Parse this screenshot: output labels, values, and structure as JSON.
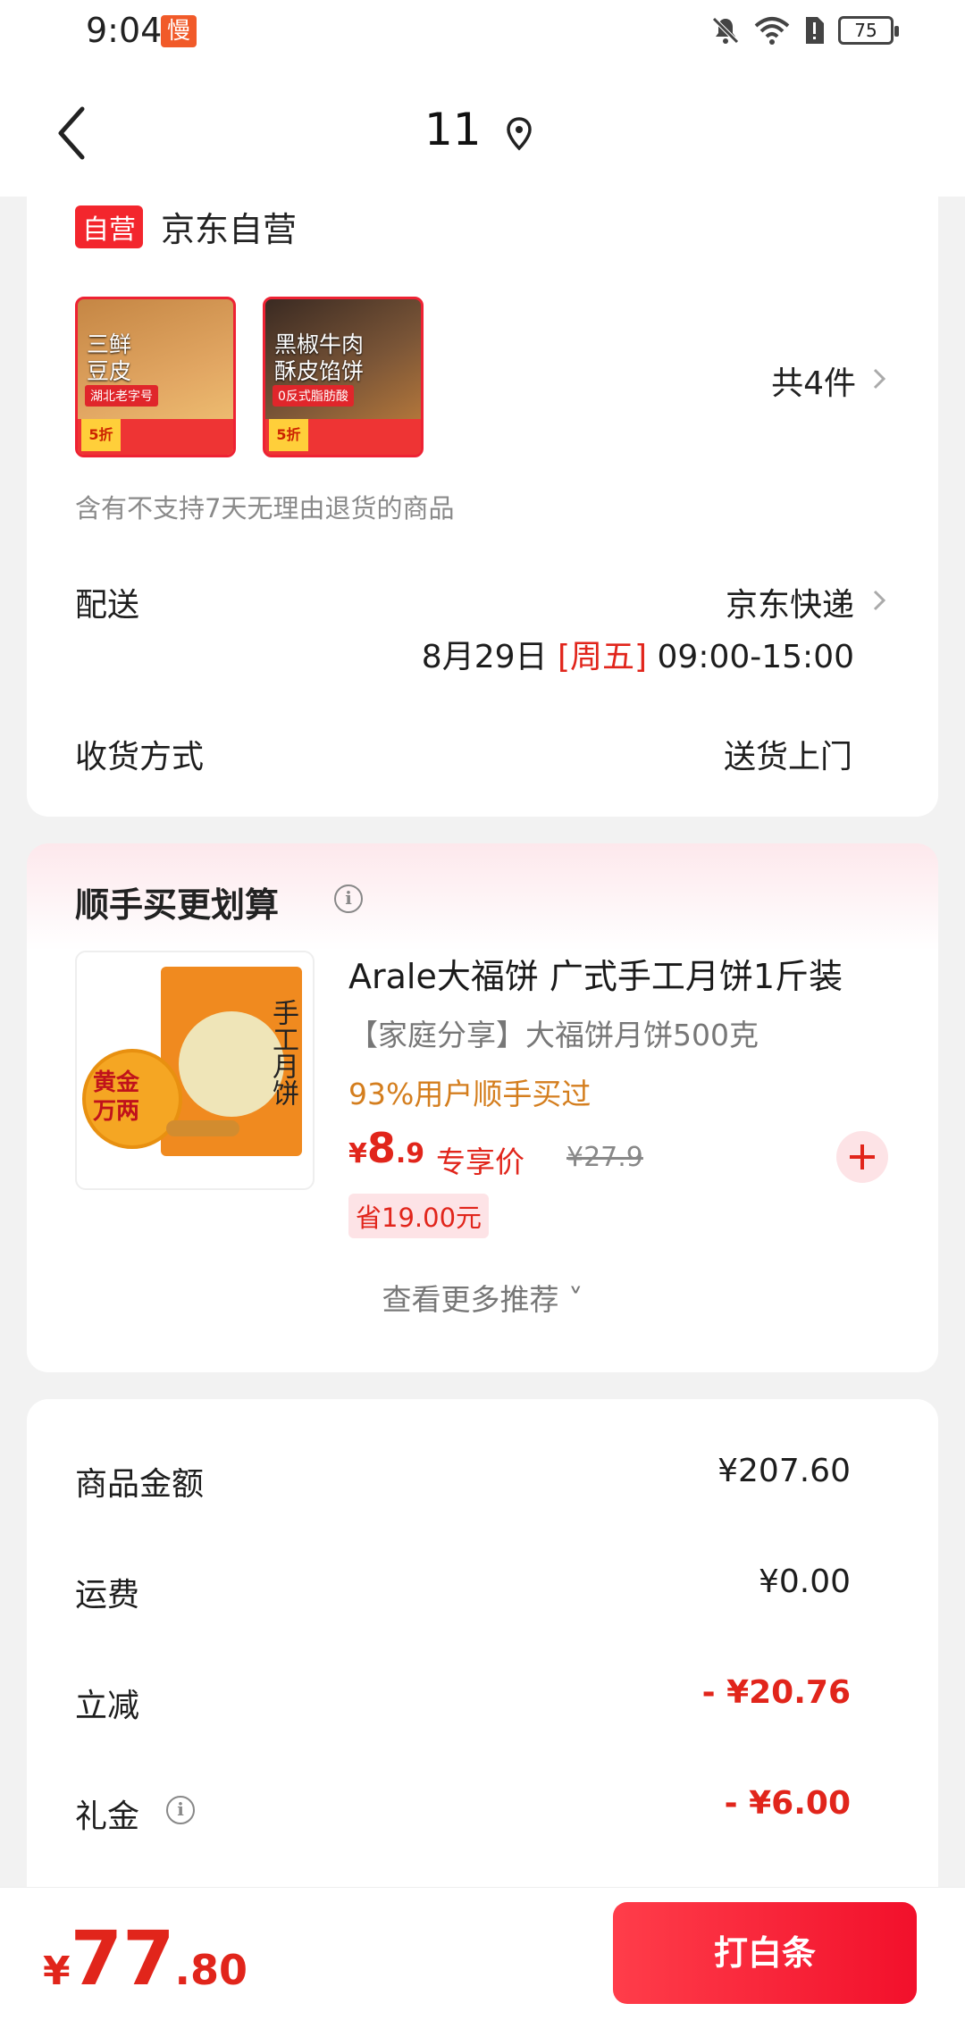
{
  "status": {
    "time": "9:04",
    "app_badge": "慢",
    "battery": "75"
  },
  "nav": {
    "title": "11"
  },
  "order": {
    "store_tag": "自营",
    "store_name": "京东自营",
    "products": [
      {
        "line1": "三鲜",
        "line2": "豆皮",
        "chip": "湖北老字号",
        "disc": "5折"
      },
      {
        "line1": "黑椒牛肉",
        "line2": "酥皮馅饼",
        "chip": "0反式脂肪酸",
        "disc": "5折"
      }
    ],
    "item_count": "共4件",
    "notice": "含有不支持7天无理由退货的商品",
    "delivery_label": "配送",
    "delivery_value": "京东快递",
    "delivery_date": "8月29日",
    "delivery_weekday": "[周五]",
    "delivery_time": "09:00-15:00",
    "receive_label": "收货方式",
    "receive_value": "送货上门"
  },
  "recommend": {
    "title": "顺手买更划算",
    "product": {
      "name": "Arale大福饼 广式手工月饼1斤装",
      "desc": "【家庭分享】大福饼月饼500克",
      "bought": "93%用户顺手买过",
      "currency": "¥",
      "price_int": "8",
      "price_dec": ".9",
      "exclusive": "专享价",
      "orig_price": "¥27.9",
      "save": "省19.00元",
      "image_word": "手工月饼",
      "cake_text": "黄金万两"
    },
    "more": "查看更多推荐 ˅"
  },
  "summary": {
    "rows": [
      {
        "label": "商品金额",
        "value": "¥207.60"
      },
      {
        "label": "运费",
        "value": "¥0.00"
      },
      {
        "label": "立减",
        "value": "- ¥20.76"
      },
      {
        "label": "礼金",
        "value": "- ¥6.00"
      }
    ]
  },
  "footer": {
    "currency": "¥",
    "total_int": "77",
    "total_dec": ".80",
    "pay_label": "打白条"
  },
  "colors": {
    "accent": "#e1251b",
    "pay_button": "#f2102b",
    "orange": "#d47e1e"
  }
}
